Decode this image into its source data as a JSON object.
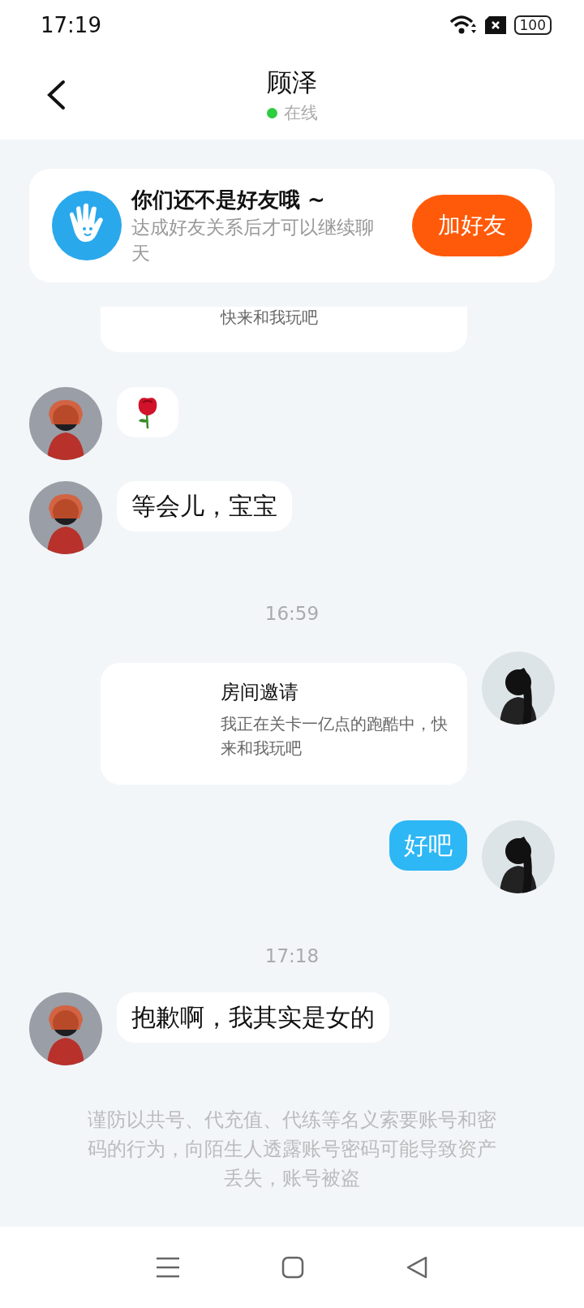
{
  "status_bar": {
    "time": "17:19",
    "battery": "100"
  },
  "header": {
    "title": "顾泽",
    "status": "在线",
    "online": true
  },
  "friend_banner": {
    "title": "你们还不是好友哦 ~",
    "subtitle": "达成好友关系后才可以继续聊天",
    "button": "加好友"
  },
  "messages": [
    {
      "kind": "card_tail",
      "text": "快来和我玩吧"
    },
    {
      "kind": "emoji"
    },
    {
      "kind": "text",
      "mine": false,
      "text": "等会儿，宝宝"
    },
    {
      "kind": "time",
      "text": "16:59"
    },
    {
      "kind": "invite",
      "title": "房间邀请",
      "text": "我正在关卡一亿点的跑酷中，快来和我玩吧"
    },
    {
      "kind": "text",
      "mine": true,
      "text": "好吧"
    },
    {
      "kind": "time",
      "text": "17:18"
    },
    {
      "kind": "text",
      "mine": false,
      "text": "抱歉啊，我其实是女的"
    }
  ],
  "notice": "谨防以共号、代充值、代练等名义索要账号和密码的行为，向陌生人透露账号密码可能导致资产丢失，账号被盗"
}
